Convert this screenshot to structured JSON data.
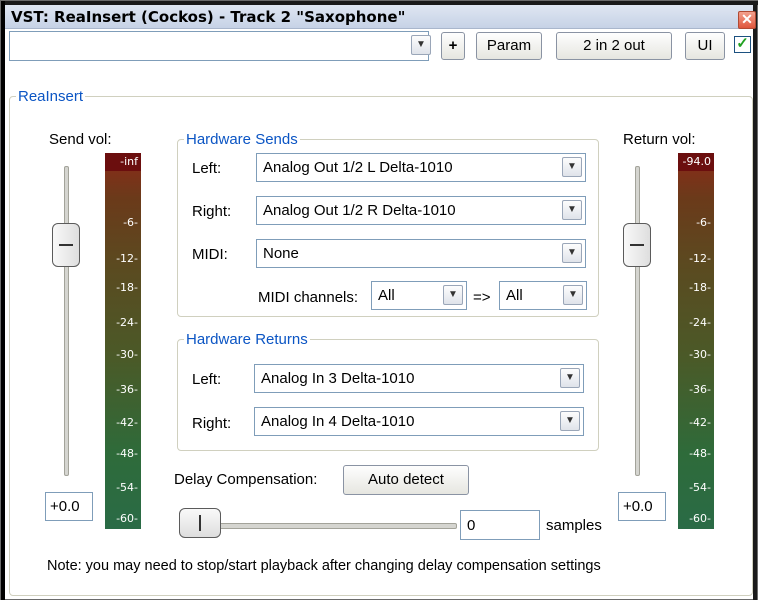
{
  "window": {
    "title": "VST: ReaInsert (Cockos) - Track 2 \"Saxophone\"",
    "close_glyph": "✕"
  },
  "toolbar": {
    "preset_value": "",
    "plus_label": "+",
    "param_label": "Param",
    "io_label": "2 in 2 out",
    "ui_label": "UI",
    "enabled_checked": true,
    "check_glyph": "✓"
  },
  "plugin": {
    "group_label": "ReaInsert",
    "send_vol_label": "Send vol:",
    "return_vol_label": "Return vol:",
    "send_vol_value": "+0.0",
    "return_vol_value": "+0.0",
    "send_meter": {
      "peak": "-inf",
      "ticks": [
        "-6-",
        "-12-",
        "-18-",
        "-24-",
        "-30-",
        "-36-",
        "-42-",
        "-48-",
        "-54-",
        "-60-"
      ]
    },
    "return_meter": {
      "peak": "-94.0",
      "ticks": [
        "-6-",
        "-12-",
        "-18-",
        "-24-",
        "-30-",
        "-36-",
        "-42-",
        "-48-",
        "-54-",
        "-60-"
      ]
    },
    "hardware_sends": {
      "group_label": "Hardware Sends",
      "left_label": "Left:",
      "left_value": "Analog Out 1/2 L Delta-1010",
      "right_label": "Right:",
      "right_value": "Analog Out 1/2 R Delta-1010",
      "midi_label": "MIDI:",
      "midi_value": "None",
      "midi_channels_label": "MIDI channels:",
      "midi_channel_from": "All",
      "midi_arrow": "=>",
      "midi_channel_to": "All"
    },
    "hardware_returns": {
      "group_label": "Hardware Returns",
      "left_label": "Left:",
      "left_value": "Analog In 3 Delta-1010",
      "right_label": "Right:",
      "right_value": "Analog In 4 Delta-1010"
    },
    "delay": {
      "label": "Delay Compensation:",
      "auto_detect_label": "Auto detect",
      "samples_value": "0",
      "samples_label": "samples"
    },
    "note": "Note: you may need to stop/start playback after changing delay compensation settings"
  },
  "icons": {
    "dropdown": "chevron-down-icon",
    "dd_glyph": "▼"
  }
}
